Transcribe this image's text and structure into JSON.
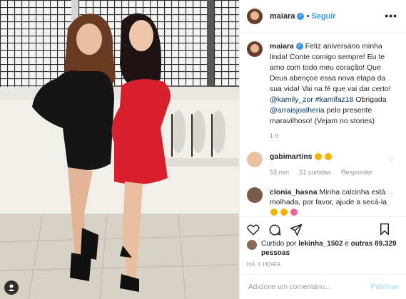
{
  "post": {
    "username": "maiara",
    "follow_label": "Seguir",
    "separator": "•",
    "more_label": "•••"
  },
  "caption": {
    "username": "maiara",
    "text_1": "Feliz aniversário minha linda! Conte comigo sempre! Eu te amo com todo meu coração! Que Deus abençoe essa nova etapa da sua vida! Vai na fé que vai dar certo!",
    "mention_1": "@kamily_zor",
    "hashtag_1": "#kamifaz18",
    "text_2": "Obrigada",
    "mention_2": "@arraisjoalheria",
    "text_3": "pelo presente maravilhoso! (Vejam no stories)",
    "time": "1 h"
  },
  "comments": [
    {
      "username": "gabimartins",
      "text": "",
      "emojis": [
        "heart-eyes-emoji",
        "heart-eyes-emoji"
      ],
      "time": "53 min",
      "likes": "51 curtidas",
      "reply_label": "Responder"
    },
    {
      "username": "clonia_hasna",
      "text": "Minha calcinha está molhada, por favor, ajude a secá-la",
      "emojis": [
        "grin-emoji",
        "grin-emoji",
        "blush-emoji"
      ]
    }
  ],
  "likes": {
    "prefix": "Curtido por",
    "user": "lekinha_1502",
    "middle": "e",
    "others": "outras 89.329 pessoas"
  },
  "timestamp": "HÁ 1 HORA",
  "add_comment": {
    "placeholder": "Adicione um comentário...",
    "publish_label": "Publicar"
  },
  "colors": {
    "link": "#00376b",
    "follow": "#3897f0",
    "publish": "#b2dffc",
    "muted": "#8e8e8e"
  }
}
